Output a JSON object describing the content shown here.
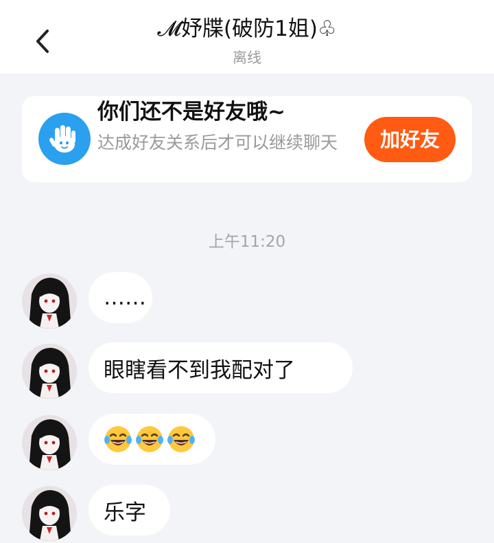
{
  "header": {
    "title": "𝓜妤牒(破防1姐)♧",
    "status": "离线"
  },
  "banner": {
    "title": "你们还不是好友哦~",
    "subtitle": "达成好友关系后才可以继续聊天",
    "button_label": "加好友",
    "icon": "hand-wave-icon"
  },
  "chat": {
    "timestamp": "上午11:20",
    "messages": [
      {
        "text": "……",
        "type": "text"
      },
      {
        "text": "眼瞎看不到我配对了",
        "type": "text"
      },
      {
        "emojis": [
          "tears-of-joy-emoji",
          "tears-of-joy-emoji",
          "tears-of-joy-emoji"
        ],
        "type": "emoji"
      },
      {
        "text": "乐字",
        "type": "text"
      }
    ]
  },
  "colors": {
    "accent": "#ff5b12",
    "banner_icon": "#2aa0ee",
    "background": "#f3f4f8"
  }
}
